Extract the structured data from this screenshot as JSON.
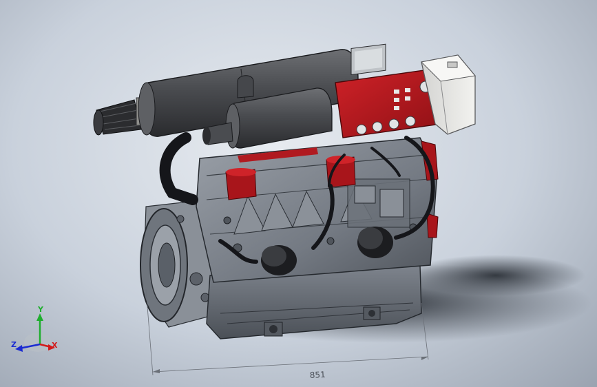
{
  "model": {
    "dimension_value": "851"
  },
  "triad": {
    "x_label": "X",
    "y_label": "Y",
    "z_label": "Z"
  },
  "colors": {
    "accent_red": "#b2161c",
    "engine_gray": "#7c828b",
    "engine_dark": "#3f444b",
    "axis_x": "#d21b1b",
    "axis_y": "#1fae2e",
    "axis_z": "#1b2bd2"
  }
}
